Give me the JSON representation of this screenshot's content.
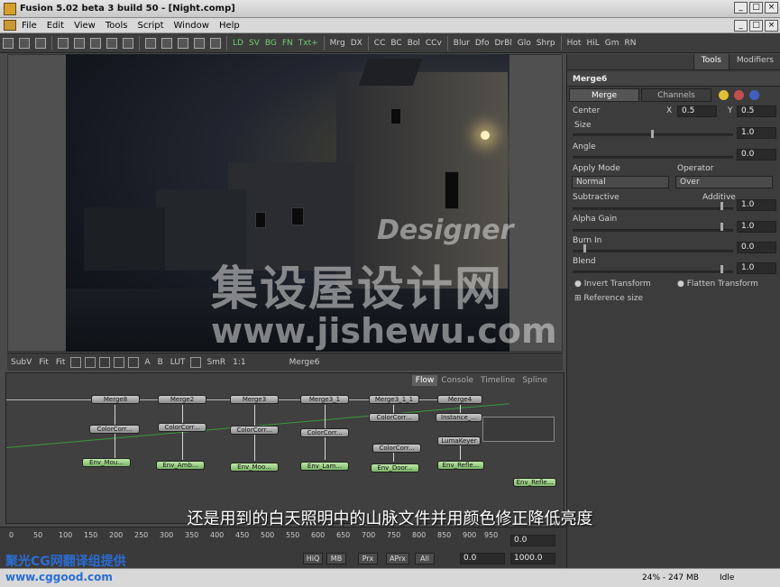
{
  "titlebar": {
    "title": "Fusion 5.02 beta 3 build 50 - [Night.comp]",
    "btn_min": "_",
    "btn_max": "□",
    "btn_close": "×"
  },
  "menu": {
    "items": [
      "File",
      "Edit",
      "View",
      "Tools",
      "Script",
      "Window",
      "Help"
    ]
  },
  "toolbar": {
    "view_modes": [
      "LD",
      "SV",
      "BG",
      "FN",
      "Txt+"
    ],
    "tools1": [
      "Mrg",
      "DX"
    ],
    "tools2": [
      "CC",
      "BC",
      "Bol",
      "CCv"
    ],
    "tools3": [
      "Blur",
      "Dfo",
      "DrBl",
      "Glo",
      "Shrp"
    ],
    "tools4": [
      "Hot",
      "HiL",
      "Gm",
      "RN"
    ]
  },
  "viewer_bar": {
    "subv": "SubV",
    "fit1": "Fit",
    "fit2": "Fit",
    "lut": "LUT",
    "smr": "SmR",
    "ratio": "1:1",
    "node": "Merge6",
    "a": "A",
    "b": "B"
  },
  "watermark": {
    "designer": "Designer",
    "cn": "集设屋设计网",
    "url": "www.jishewu.com"
  },
  "inspector": {
    "tab_tools": "Tools",
    "tab_modifiers": "Modifiers",
    "node_name": "Merge6",
    "tab_merge": "Merge",
    "tab_channels": "Channels",
    "center_label": "Center",
    "center_x_label": "X",
    "center_x": "0.5",
    "center_y_label": "Y",
    "center_y": "0.5",
    "size_label": "Size",
    "size_val": "1.0",
    "angle_label": "Angle",
    "angle_val": "0.0",
    "apply_mode_label": "Apply Mode",
    "apply_mode": "Normal",
    "operator_label": "Operator",
    "operator": "Over",
    "subtractive_label": "Subtractive",
    "additive_label": "Additive",
    "subadd_val": "1.0",
    "alpha_gain_label": "Alpha Gain",
    "alpha_gain_val": "1.0",
    "burn_in_label": "Burn In",
    "burn_in_val": "0.0",
    "blend_label": "Blend",
    "blend_val": "1.0",
    "invert_transform": "Invert Transform",
    "flatten_transform": "Flatten Transform",
    "reference_size": "Reference size"
  },
  "flow": {
    "tabs": [
      "Flow",
      "Console",
      "Timeline",
      "Spline"
    ],
    "merges": [
      "Merge8",
      "Merge2",
      "Merge3",
      "Merge3_1",
      "Merge3_1_1",
      "Merge4"
    ],
    "cc": [
      "ColorCorr...",
      "ColorCorr...",
      "ColorCorr...",
      "ColorCorr...",
      "ColorCorr...",
      "ColorCorr..."
    ],
    "instance": "Instance_...",
    "lumakeyer": "LumaKeyer",
    "envs": [
      "Env_Mou...",
      "Env_Amb...",
      "Env_Moo...",
      "Env_Lam...",
      "Env_Door...",
      "Env_Refle...",
      "Env_Refle..."
    ]
  },
  "subtitle": "还是用到的白天照明中的山脉文件并用颜色修正降低亮度",
  "timeline": {
    "ticks": [
      "0",
      "50",
      "100",
      "150",
      "200",
      "250",
      "300",
      "350",
      "400",
      "450",
      "500",
      "550",
      "600",
      "650",
      "700",
      "750",
      "800",
      "850",
      "900",
      "950"
    ],
    "val1": "0.0",
    "val2": "0.0",
    "val3": "1000.0",
    "hiq": "HiQ",
    "mb": "MB",
    "prx": "Prx",
    "aprx": "APrx",
    "all": "All"
  },
  "credit": {
    "cn": "聚光CG网翻译组提供",
    "url": "www.cggood.com"
  },
  "status": {
    "mem": "24% - 247 MB",
    "state": "Idle"
  }
}
